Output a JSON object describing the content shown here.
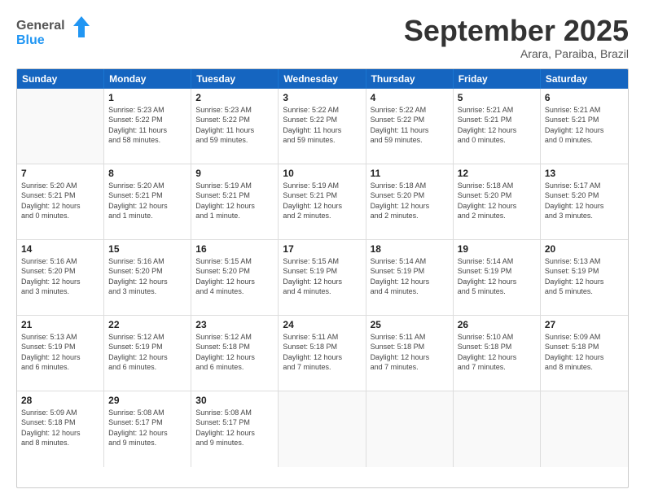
{
  "header": {
    "logo_general": "General",
    "logo_blue": "Blue",
    "month_title": "September 2025",
    "subtitle": "Arara, Paraiba, Brazil"
  },
  "weekdays": [
    "Sunday",
    "Monday",
    "Tuesday",
    "Wednesday",
    "Thursday",
    "Friday",
    "Saturday"
  ],
  "rows": [
    [
      {
        "day": "",
        "info": ""
      },
      {
        "day": "1",
        "info": "Sunrise: 5:23 AM\nSunset: 5:22 PM\nDaylight: 11 hours\nand 58 minutes."
      },
      {
        "day": "2",
        "info": "Sunrise: 5:23 AM\nSunset: 5:22 PM\nDaylight: 11 hours\nand 59 minutes."
      },
      {
        "day": "3",
        "info": "Sunrise: 5:22 AM\nSunset: 5:22 PM\nDaylight: 11 hours\nand 59 minutes."
      },
      {
        "day": "4",
        "info": "Sunrise: 5:22 AM\nSunset: 5:22 PM\nDaylight: 11 hours\nand 59 minutes."
      },
      {
        "day": "5",
        "info": "Sunrise: 5:21 AM\nSunset: 5:21 PM\nDaylight: 12 hours\nand 0 minutes."
      },
      {
        "day": "6",
        "info": "Sunrise: 5:21 AM\nSunset: 5:21 PM\nDaylight: 12 hours\nand 0 minutes."
      }
    ],
    [
      {
        "day": "7",
        "info": "Sunrise: 5:20 AM\nSunset: 5:21 PM\nDaylight: 12 hours\nand 0 minutes."
      },
      {
        "day": "8",
        "info": "Sunrise: 5:20 AM\nSunset: 5:21 PM\nDaylight: 12 hours\nand 1 minute."
      },
      {
        "day": "9",
        "info": "Sunrise: 5:19 AM\nSunset: 5:21 PM\nDaylight: 12 hours\nand 1 minute."
      },
      {
        "day": "10",
        "info": "Sunrise: 5:19 AM\nSunset: 5:21 PM\nDaylight: 12 hours\nand 2 minutes."
      },
      {
        "day": "11",
        "info": "Sunrise: 5:18 AM\nSunset: 5:20 PM\nDaylight: 12 hours\nand 2 minutes."
      },
      {
        "day": "12",
        "info": "Sunrise: 5:18 AM\nSunset: 5:20 PM\nDaylight: 12 hours\nand 2 minutes."
      },
      {
        "day": "13",
        "info": "Sunrise: 5:17 AM\nSunset: 5:20 PM\nDaylight: 12 hours\nand 3 minutes."
      }
    ],
    [
      {
        "day": "14",
        "info": "Sunrise: 5:16 AM\nSunset: 5:20 PM\nDaylight: 12 hours\nand 3 minutes."
      },
      {
        "day": "15",
        "info": "Sunrise: 5:16 AM\nSunset: 5:20 PM\nDaylight: 12 hours\nand 3 minutes."
      },
      {
        "day": "16",
        "info": "Sunrise: 5:15 AM\nSunset: 5:20 PM\nDaylight: 12 hours\nand 4 minutes."
      },
      {
        "day": "17",
        "info": "Sunrise: 5:15 AM\nSunset: 5:19 PM\nDaylight: 12 hours\nand 4 minutes."
      },
      {
        "day": "18",
        "info": "Sunrise: 5:14 AM\nSunset: 5:19 PM\nDaylight: 12 hours\nand 4 minutes."
      },
      {
        "day": "19",
        "info": "Sunrise: 5:14 AM\nSunset: 5:19 PM\nDaylight: 12 hours\nand 5 minutes."
      },
      {
        "day": "20",
        "info": "Sunrise: 5:13 AM\nSunset: 5:19 PM\nDaylight: 12 hours\nand 5 minutes."
      }
    ],
    [
      {
        "day": "21",
        "info": "Sunrise: 5:13 AM\nSunset: 5:19 PM\nDaylight: 12 hours\nand 6 minutes."
      },
      {
        "day": "22",
        "info": "Sunrise: 5:12 AM\nSunset: 5:19 PM\nDaylight: 12 hours\nand 6 minutes."
      },
      {
        "day": "23",
        "info": "Sunrise: 5:12 AM\nSunset: 5:18 PM\nDaylight: 12 hours\nand 6 minutes."
      },
      {
        "day": "24",
        "info": "Sunrise: 5:11 AM\nSunset: 5:18 PM\nDaylight: 12 hours\nand 7 minutes."
      },
      {
        "day": "25",
        "info": "Sunrise: 5:11 AM\nSunset: 5:18 PM\nDaylight: 12 hours\nand 7 minutes."
      },
      {
        "day": "26",
        "info": "Sunrise: 5:10 AM\nSunset: 5:18 PM\nDaylight: 12 hours\nand 7 minutes."
      },
      {
        "day": "27",
        "info": "Sunrise: 5:09 AM\nSunset: 5:18 PM\nDaylight: 12 hours\nand 8 minutes."
      }
    ],
    [
      {
        "day": "28",
        "info": "Sunrise: 5:09 AM\nSunset: 5:18 PM\nDaylight: 12 hours\nand 8 minutes."
      },
      {
        "day": "29",
        "info": "Sunrise: 5:08 AM\nSunset: 5:17 PM\nDaylight: 12 hours\nand 9 minutes."
      },
      {
        "day": "30",
        "info": "Sunrise: 5:08 AM\nSunset: 5:17 PM\nDaylight: 12 hours\nand 9 minutes."
      },
      {
        "day": "",
        "info": ""
      },
      {
        "day": "",
        "info": ""
      },
      {
        "day": "",
        "info": ""
      },
      {
        "day": "",
        "info": ""
      }
    ]
  ]
}
